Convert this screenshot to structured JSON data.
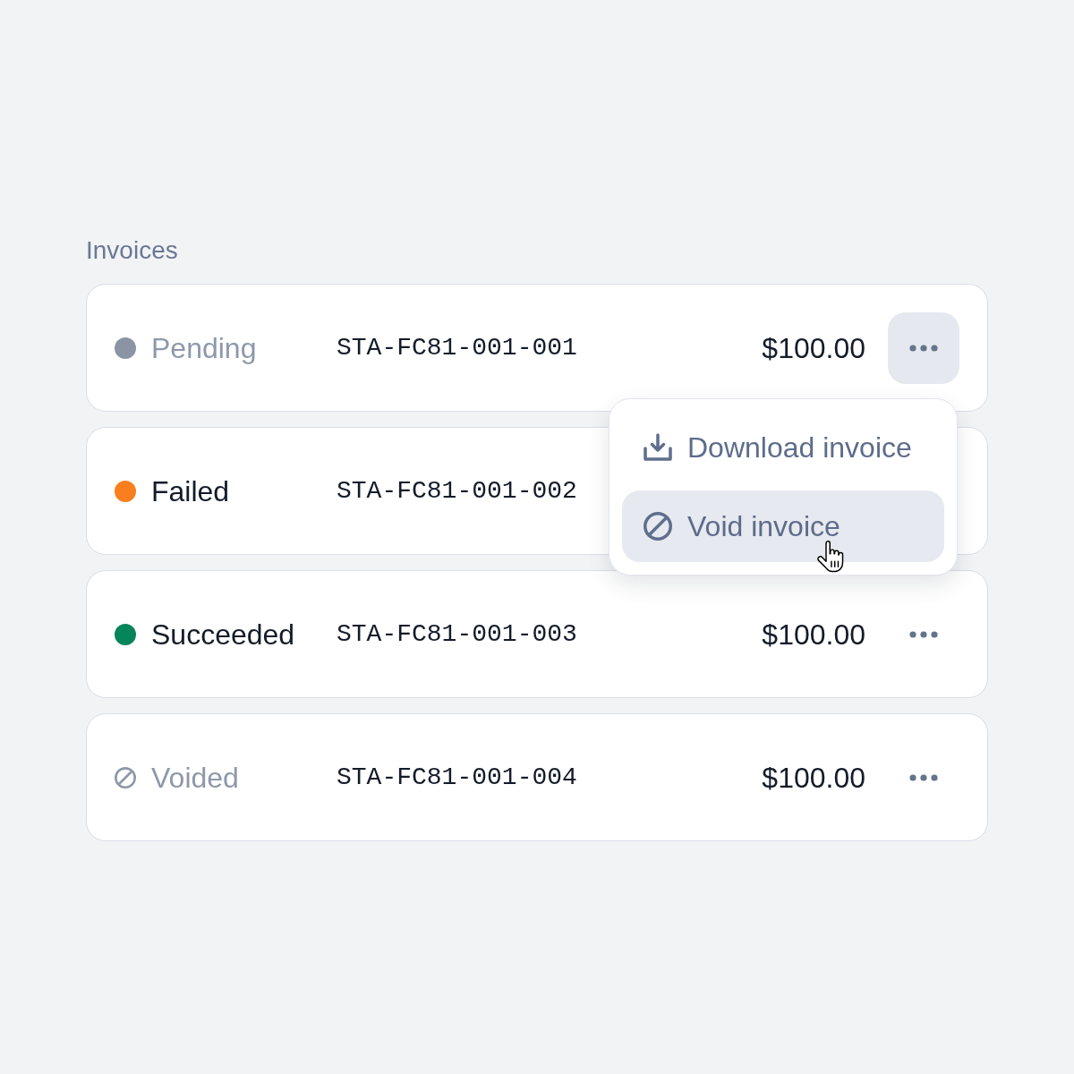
{
  "title": "Invoices",
  "invoices": [
    {
      "status": {
        "kind": "dot",
        "label": "Pending",
        "color": "#8b94a4",
        "muted": true
      },
      "number": "STA-FC81-001-001",
      "amount": "$100.00",
      "menu_open": true
    },
    {
      "status": {
        "kind": "dot",
        "label": "Failed",
        "color": "#f97f1e",
        "muted": false
      },
      "number": "STA-FC81-001-002"
    },
    {
      "status": {
        "kind": "dot",
        "label": "Succeeded",
        "color": "#07855a",
        "muted": false
      },
      "number": "STA-FC81-001-003",
      "amount": "$100.00",
      "menu_open": false
    },
    {
      "status": {
        "kind": "void",
        "label": "Voided",
        "muted": true
      },
      "number": "STA-FC81-001-004",
      "amount": "$100.00",
      "menu_open": false
    }
  ],
  "menu": {
    "items": [
      {
        "kind": "download",
        "label": "Download invoice",
        "highlighted": false
      },
      {
        "kind": "void",
        "label": "Void invoice",
        "highlighted": true
      }
    ]
  }
}
